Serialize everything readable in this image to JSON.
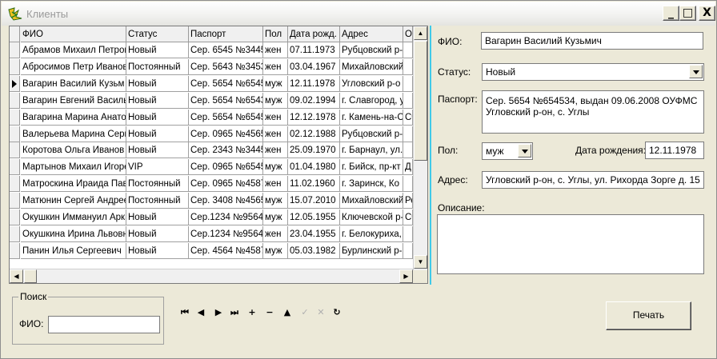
{
  "window": {
    "title": "Клиенты"
  },
  "title_buttons": {
    "minimize": "_",
    "maximize": "□",
    "close": "X"
  },
  "grid": {
    "columns": [
      "ФИО",
      "Статус",
      "Паспорт",
      "Пол",
      "Дата рожд.",
      "Адрес",
      "О"
    ],
    "rows": [
      [
        "Абрамов Михаил Петров",
        "Новый",
        "Сер. 6545 №3445",
        "жен",
        "07.11.1973",
        "Рубцовский р-",
        ""
      ],
      [
        "Абросимов Петр Иванов",
        "Постоянный",
        "Сер. 5643 №3453",
        "жен",
        "03.04.1967",
        "Михайловский",
        ""
      ],
      [
        "Вагарин Василий Кузьм",
        "Новый",
        "Сер. 5654 №6545",
        "муж",
        "12.11.1978",
        "Угловский р-о",
        ""
      ],
      [
        "Вагарин Евгений Василь",
        "Новый",
        "Сер. 5654 №6543",
        "муж",
        "09.02.1994",
        "г. Славгород, у",
        ""
      ],
      [
        "Вагарина Марина Анато",
        "Новый",
        "Сер. 5654 №6545",
        "жен",
        "12.12.1978",
        "г. Камень-на-С",
        "Сч"
      ],
      [
        "Валерьева Марина Серг",
        "Новый",
        "Сер. 0965 №4565",
        "жен",
        "02.12.1988",
        "Рубцовский р-",
        ""
      ],
      [
        "Коротова Ольга Иванов",
        "Новый",
        "Сер. 2343 №3445",
        "жен",
        "25.09.1970",
        "г. Барнаул, ул.",
        ""
      ],
      [
        "Мартынов Михаил Игоре",
        "VIP",
        "Сер. 0965 №6545",
        "муж",
        "01.04.1980",
        "г. Бийск, пр-кт",
        "Д"
      ],
      [
        "Матроскина Ираида Пав",
        "Постоянный",
        "Сер. 0965 №4587",
        "жен",
        "11.02.1960",
        "г. Заринск, Ко",
        ""
      ],
      [
        "Матюнин Сергей Андрее",
        "Постоянный",
        "Сер. 3408 №4565",
        "муж",
        "15.07.2010",
        "Михайловский",
        "Ре"
      ],
      [
        "Окушкин Иммануил Арка",
        "Новый",
        "Сер.1234 №9564",
        "муж",
        "12.05.1955",
        "Ключевской р-",
        "Сч"
      ],
      [
        "Окушкина Ирина Львовн",
        "Новый",
        "Сер.1234 №9564",
        "жен",
        "23.04.1955",
        "г. Белокуриха, с",
        ""
      ],
      [
        "Панин Илья Сергеевич",
        "Новый",
        "Сер. 4564 №4587",
        "муж",
        "05.03.1982",
        "Бурлинский р-",
        ""
      ]
    ],
    "current_row": 2
  },
  "detail": {
    "fio_label": "ФИО:",
    "fio_value": "Вагарин Василий Кузьмич",
    "status_label": "Статус:",
    "status_value": "Новый",
    "passport_label": "Паспорт:",
    "passport_line1": "Сер. 5654 №654534, выдан 09.06.2008 ОУФМС",
    "passport_line2": "Угловский р-он, с. Углы",
    "sex_label": "Пол:",
    "sex_value": "муж",
    "birth_label": "Дата рождения:",
    "birth_value": "12.11.1978",
    "address_label": "Адрес:",
    "address_value": "Угловский р-он, с. Углы, ул. Рихорда Зорге д. 15",
    "description_label": "Описание:",
    "description_value": ""
  },
  "search": {
    "group_title": "Поиск",
    "fio_label": "ФИО:",
    "fio_value": ""
  },
  "navigator": {
    "first": "⏮",
    "prior": "◀",
    "next": "▶",
    "last": "⏭",
    "insert": "+",
    "delete": "−",
    "edit": "▲",
    "post": "✓",
    "cancel": "✕",
    "refresh": "↻"
  },
  "print_button": "Печать",
  "colors": {
    "accent_splitter": "#3fc9e8",
    "face": "#ece9d8"
  }
}
